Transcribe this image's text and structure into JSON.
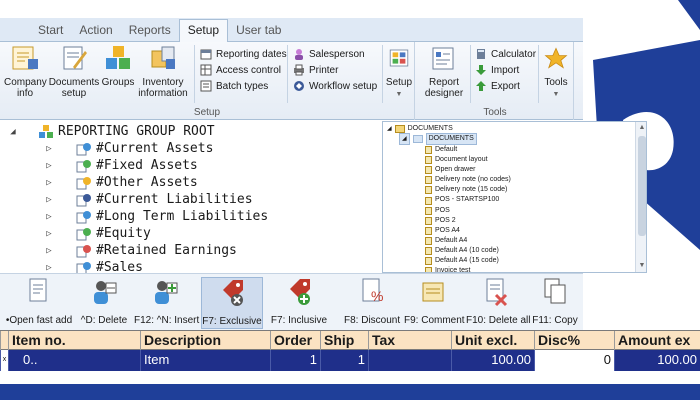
{
  "ribbon": {
    "tabs": [
      "Start",
      "Action",
      "Reports",
      "Setup",
      "User tab"
    ],
    "active_tab": "Setup",
    "groups": {
      "setup": {
        "label": "Setup",
        "big": [
          {
            "label": "Company info",
            "icon": "company-info-icon"
          },
          {
            "label": "Documents setup",
            "icon": "documents-setup-icon"
          },
          {
            "label": "Groups",
            "icon": "groups-icon"
          },
          {
            "label": "Inventory information",
            "icon": "inventory-icon"
          }
        ],
        "small_col1": [
          "Reporting dates",
          "Access control",
          "Batch types"
        ],
        "small_col2": [
          "Salesperson",
          "Printer",
          "Workflow setup"
        ],
        "dropdown": "Setup"
      },
      "tools": {
        "label": "Tools",
        "big": [
          {
            "label": "Report designer",
            "icon": "report-designer-icon"
          }
        ],
        "small": [
          "Calculator",
          "Import",
          "Export"
        ],
        "dropdown": "Tools"
      }
    }
  },
  "tree": {
    "root": "REPORTING GROUP ROOT",
    "items": [
      "#Current Assets",
      "#Fixed Assets",
      "#Other Assets",
      "#Current Liabilities",
      "#Long Term Liabilities",
      "#Equity",
      "#Retained Earnings",
      "#Sales"
    ]
  },
  "documents": {
    "root": "DOCUMENTS",
    "folder": "DOCUMENTS",
    "items": [
      "Default",
      "Document layout",
      "Open drawer",
      "Delivery note (no codes)",
      "Delivery note (15 code)",
      "POS - STARTSP100",
      "POS",
      "POS 2",
      "POS A4",
      "Default A4",
      "Default A4 (10 code)",
      "Default A4 (15 code)",
      "Invoice test"
    ]
  },
  "toolbar": {
    "buttons": [
      {
        "label": "•Open fast add",
        "icon": "open-fast-add-icon",
        "pressed": false
      },
      {
        "label": "^D: Delete",
        "icon": "delete-user-icon",
        "pressed": false
      },
      {
        "label": "F12: ^N: Insert",
        "icon": "insert-user-icon",
        "pressed": false
      },
      {
        "label": "F7: Exclusive",
        "icon": "exclusive-tag-icon",
        "pressed": true
      },
      {
        "label": "F7: Inclusive",
        "icon": "inclusive-tag-icon",
        "pressed": false
      },
      {
        "label": "F8: Discount",
        "icon": "discount-icon",
        "pressed": false
      },
      {
        "label": "F9: Comment",
        "icon": "comment-icon",
        "pressed": false
      },
      {
        "label": "F10: Delete all",
        "icon": "delete-all-icon",
        "pressed": false
      },
      {
        "label": "F11: Copy",
        "icon": "copy-icon",
        "pressed": false
      }
    ]
  },
  "grid": {
    "headers": [
      "Item no.",
      "Description",
      "Order",
      "Ship",
      "Tax",
      "Unit excl.",
      "Disc%",
      "Amount ex"
    ],
    "rows": [
      {
        "marker": "x",
        "item_no": "0..",
        "description": "Item",
        "order": "1",
        "ship": "1",
        "tax": "",
        "unit_excl": "100.00",
        "disc": "0",
        "amount": "100.00"
      }
    ]
  },
  "colors": {
    "accent_blue": "#1f3f99",
    "grid_header": "#fbe3c2",
    "selected_row": "#1f2f8a"
  }
}
